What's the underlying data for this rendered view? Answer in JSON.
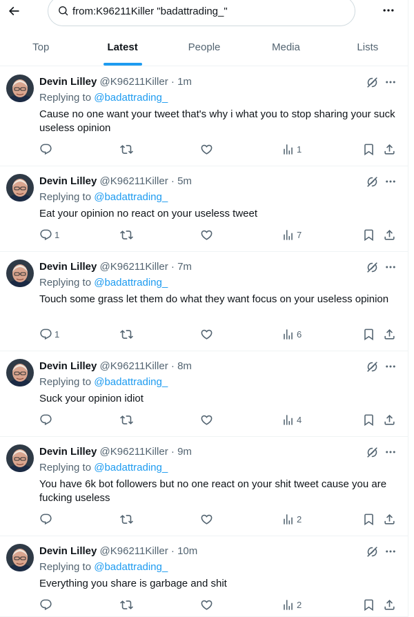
{
  "search": {
    "query": "from:K96211Killer \"badattrading_\""
  },
  "tabs": [
    {
      "label": "Top"
    },
    {
      "label": "Latest"
    },
    {
      "label": "People"
    },
    {
      "label": "Media"
    },
    {
      "label": "Lists"
    }
  ],
  "active_tab": "Latest",
  "colors": {
    "accent": "#1d9bf0",
    "text": "#0f1419",
    "secondary": "#536471",
    "border": "#eff3f4"
  },
  "tweets": [
    {
      "name": "Devin Lilley",
      "handle": "@K96211Killer",
      "dot": "·",
      "time": "1m",
      "replying_prefix": "Replying to",
      "replying_to": "@badattrading_",
      "text": "Cause no one want your tweet that's why i what you to stop sharing your suck useless opinion",
      "replies": "",
      "retweets": "",
      "likes": "",
      "views": "1"
    },
    {
      "name": "Devin Lilley",
      "handle": "@K96211Killer",
      "dot": "·",
      "time": "5m",
      "replying_prefix": "Replying to",
      "replying_to": "@badattrading_",
      "text": "Eat your opinion no react on your useless tweet",
      "replies": "1",
      "retweets": "",
      "likes": "",
      "views": "7"
    },
    {
      "name": "Devin Lilley",
      "handle": "@K96211Killer",
      "dot": "·",
      "time": "7m",
      "replying_prefix": "Replying to",
      "replying_to": "@badattrading_",
      "text": "Touch some grass let them do what they want focus on your useless opinion",
      "replies": "1",
      "retweets": "",
      "likes": "",
      "views": "6"
    },
    {
      "name": "Devin Lilley",
      "handle": "@K96211Killer",
      "dot": "·",
      "time": "8m",
      "replying_prefix": "Replying to",
      "replying_to": "@badattrading_",
      "text": "Suck your opinion idiot",
      "replies": "",
      "retweets": "",
      "likes": "",
      "views": "4"
    },
    {
      "name": "Devin Lilley",
      "handle": "@K96211Killer",
      "dot": "·",
      "time": "9m",
      "replying_prefix": "Replying to",
      "replying_to": "@badattrading_",
      "text": "You have 6k bot followers but no one react on your shit tweet cause you are fucking useless",
      "replies": "",
      "retweets": "",
      "likes": "",
      "views": "2"
    },
    {
      "name": "Devin Lilley",
      "handle": "@K96211Killer",
      "dot": "·",
      "time": "10m",
      "replying_prefix": "Replying to",
      "replying_to": "@badattrading_",
      "text": "Everything you share is garbage and shit",
      "replies": "",
      "retweets": "",
      "likes": "",
      "views": "2"
    }
  ],
  "icons": {
    "back": "arrow-left-icon",
    "search": "search-icon",
    "more": "more-horizontal-icon",
    "grok": "grok-icon",
    "reply": "reply-icon",
    "retweet": "retweet-icon",
    "like": "heart-icon",
    "views": "views-icon",
    "bookmark": "bookmark-icon",
    "share": "share-icon"
  }
}
